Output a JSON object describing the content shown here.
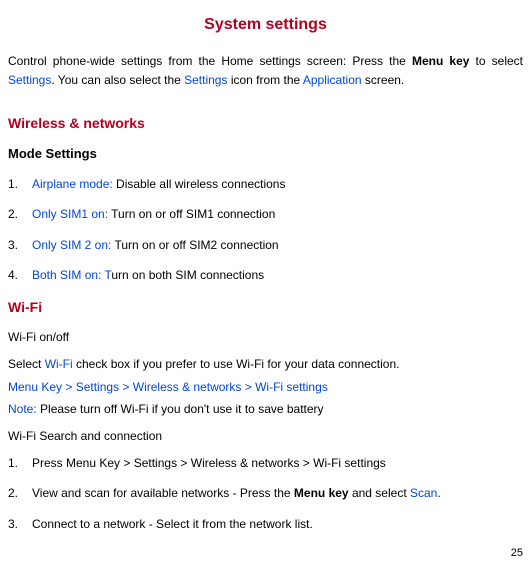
{
  "title": "System settings",
  "intro": {
    "t1": "Control phone-wide settings from the Home settings screen: Press the ",
    "menu_key": "Menu key",
    "t2": " to select ",
    "settings1": "Settings",
    "t3": ". You can also select the ",
    "settings2": "Settings",
    "t4": " icon from the ",
    "application": "Application",
    "t5": " screen."
  },
  "wireless_heading": "Wireless & networks",
  "mode_heading": "Mode Settings",
  "mode_items": [
    {
      "num": "1.",
      "blue": "Airplane mode:",
      "rest": " Disable all wireless connections",
      "serif": false
    },
    {
      "num": "2.",
      "blue": "Only SIM1 on:",
      "rest": " Turn on or off SIM1 connection",
      "serif": true
    },
    {
      "num": "3.",
      "blue": "Only SIM 2 on:",
      "rest": " Turn on or off SIM2 connection",
      "serif": true
    },
    {
      "num": "4.",
      "blue": "Both SIM on: T",
      "rest": "urn on both SIM connections",
      "serif": false
    }
  ],
  "wifi_heading": "Wi-Fi",
  "wifi_onoff": "Wi-Fi on/off",
  "wifi_select": {
    "t1": "Select ",
    "wifi": "Wi-Fi",
    "t2": " check box if you prefer to use Wi-Fi for your data connection."
  },
  "wifi_path": "Menu Key > Settings > Wireless & networks > Wi-Fi settings",
  "note_label": "Note:",
  "note_text": " Please turn off Wi-Fi if you don't use it to save battery",
  "search_heading": "Wi-Fi Search and connection",
  "search_items": [
    {
      "num": "1.",
      "pre": "Press Menu Key > Settings > Wireless & networks > Wi-Fi settings",
      "bold": "",
      "blue": ""
    },
    {
      "num": "2.",
      "pre": "View and scan for available networks - Press the ",
      "bold": "Menu key",
      "mid": " and select ",
      "blue": "Scan",
      "post": "."
    },
    {
      "num": "3.",
      "pre": "Connect to a network - Select it from the network list.",
      "bold": "",
      "blue": ""
    }
  ],
  "page_number": "25"
}
